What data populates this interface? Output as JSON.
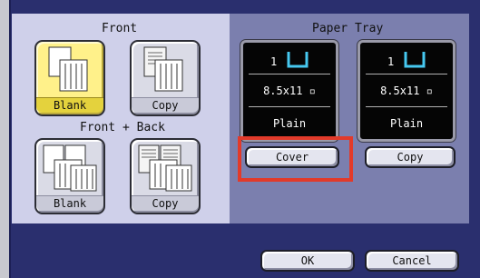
{
  "front": {
    "title": "Front",
    "blank_label": "Blank",
    "copy_label": "Copy"
  },
  "front_back": {
    "title": "Front + Back",
    "blank_label": "Blank",
    "copy_label": "Copy"
  },
  "paper_tray": {
    "title": "Paper Tray",
    "trays": [
      {
        "number": "1",
        "size": "8.5x11",
        "type": "Plain",
        "button_label": "Cover"
      },
      {
        "number": "1",
        "size": "8.5x11",
        "type": "Plain",
        "button_label": "Copy"
      }
    ]
  },
  "footer": {
    "ok_label": "OK",
    "cancel_label": "Cancel"
  },
  "colors": {
    "selected_tile": "#fff18a",
    "highlight": "#e23a2a",
    "tray_icon": "#46c8f0"
  }
}
